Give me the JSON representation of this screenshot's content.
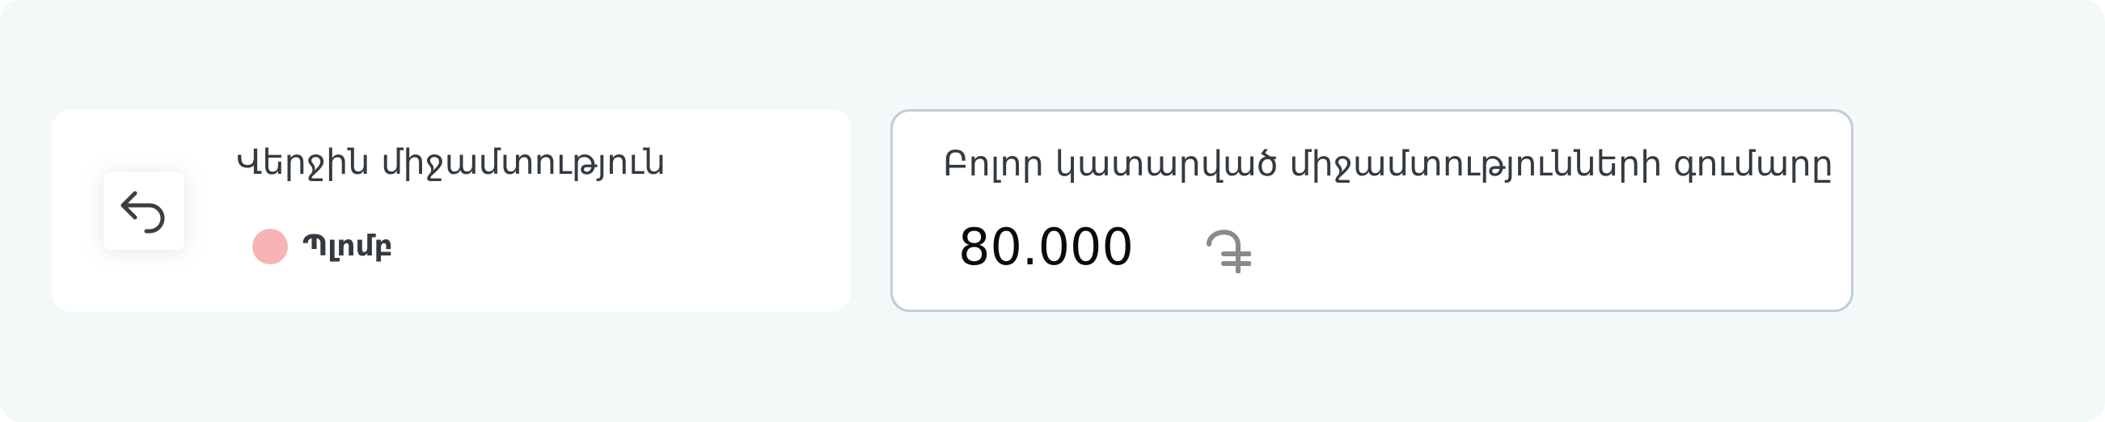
{
  "last_transaction": {
    "title": "Վերջին միջամտություն",
    "icon": "undo-arrow-icon",
    "status": {
      "label": "Պլոմբ",
      "color": "#f7b4b4"
    }
  },
  "total": {
    "title": "Բոլոր կատարված միջամտությունների գումարը",
    "amount": "80.000",
    "currency_icon": "armenian-dram-icon"
  },
  "colors": {
    "background": "#f3f8f8",
    "card": "#ffffff",
    "card_border": "#c3cbd7",
    "text": "#333a40",
    "amount_text": "#0a0a0a",
    "icon": "#3b3f43",
    "currency": "#8a8a8a"
  }
}
